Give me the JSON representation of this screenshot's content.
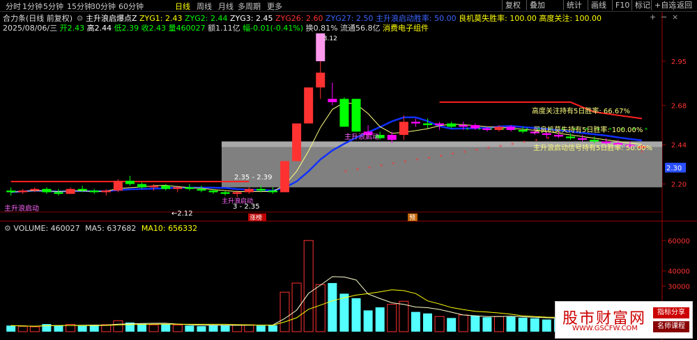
{
  "toolbar": {
    "periods": [
      "分时",
      "1分钟",
      "5分钟",
      "15分钟",
      "30分钟",
      "60分钟",
      "日线",
      "周线",
      "月线",
      "多周期",
      "更多"
    ],
    "active_period": "日线",
    "right_buttons": [
      "复权",
      "叠加",
      "统计",
      "画线",
      "F10",
      "标记",
      "+自选",
      "返回"
    ]
  },
  "info": {
    "line1_prefix": "合力条(日线 前复权)",
    "indicator_name": "主升浪启爆点Z",
    "zyg1": "ZYG1: 2.43",
    "zyg2": "ZYG2: 2.44",
    "zyg3": "ZYG3: 2.45",
    "zyg26": "ZYG26: 2.60",
    "zyg27": "ZYG27: 2.50",
    "rate_main": "主升浪启动胜率: 50.00",
    "rate_good": "良机莫失胜率: 100.00",
    "rate_focus": "高度关注: 100.00",
    "date": "2025/08/06/三",
    "open": "开2.43",
    "high": "高2.44",
    "low": "低2.39",
    "close": "收2.43",
    "volume": "量460027",
    "amount": "额1.11亿",
    "change": "幅-0.01(-0.41%)",
    "turnover": "换0.81%",
    "float": "流通56.8亿",
    "sector": "消费电子组件",
    "close_icon": "close-icon",
    "settings_icon": "gear-icon",
    "zoom_in_icon": "zoom-in-icon",
    "zoom_out_icon": "zoom-out-icon"
  },
  "annotations": {
    "peak": "3.12",
    "focus_rate": "高度关注持有5日胜率:  66.67%",
    "good_rate": "买良机莫失持有5日胜率:  100.00%",
    "main_rate": "主升浪启动信号持有5日胜率:  50.00%",
    "band_top": "2.35 - 2.39",
    "band_bottom": "3 - 2.35",
    "low_mark": "←2.12",
    "start_left": "主升浪启动",
    "start_mid": "主升浪启动",
    "start_right": "主升浪启动",
    "limit_tag": "涨榜",
    "pre_tag": "预",
    "current_price": "2.30"
  },
  "price_axis": [
    "2.95",
    "2.68",
    "2.44",
    "2.20"
  ],
  "volume_info": {
    "label": "VOLUME: 460027",
    "ma5": "MA5: 637682",
    "ma10": "MA10: 656332"
  },
  "volume_axis": [
    "60000",
    "40000",
    "30000"
  ],
  "watermark": {
    "title": "股市财富网",
    "url": "WWW.GSCFW.COM",
    "tag1": "指标分享",
    "tag2": "名师课程"
  },
  "colors": {
    "up": "#ff3232",
    "down": "#00ff00",
    "pink": "#ff00ff",
    "volume": "#54ffff",
    "ma": "#0000ff",
    "band": "#808080"
  },
  "chart_data": {
    "type": "candlestick",
    "price_range": [
      2.05,
      3.12
    ],
    "candles": [
      [
        2.16,
        2.18,
        2.13,
        2.15
      ],
      [
        2.15,
        2.17,
        2.14,
        2.16
      ],
      [
        2.16,
        2.18,
        2.15,
        2.17
      ],
      [
        2.17,
        2.18,
        2.14,
        2.15
      ],
      [
        2.15,
        2.17,
        2.13,
        2.14
      ],
      [
        2.14,
        2.18,
        2.14,
        2.17
      ],
      [
        2.17,
        2.19,
        2.15,
        2.16
      ],
      [
        2.16,
        2.17,
        2.14,
        2.15
      ],
      [
        2.15,
        2.17,
        2.13,
        2.16
      ],
      [
        2.16,
        2.23,
        2.15,
        2.22
      ],
      [
        2.22,
        2.25,
        2.19,
        2.2
      ],
      [
        2.2,
        2.21,
        2.17,
        2.18
      ],
      [
        2.18,
        2.2,
        2.16,
        2.19
      ],
      [
        2.19,
        2.2,
        2.16,
        2.17
      ],
      [
        2.17,
        2.19,
        2.15,
        2.18
      ],
      [
        2.18,
        2.2,
        2.16,
        2.17
      ],
      [
        2.17,
        2.19,
        2.15,
        2.16
      ],
      [
        2.16,
        2.17,
        2.14,
        2.15
      ],
      [
        2.15,
        2.16,
        2.13,
        2.14
      ],
      [
        2.14,
        2.16,
        2.12,
        2.15
      ],
      [
        2.15,
        2.18,
        2.14,
        2.17
      ],
      [
        2.17,
        2.19,
        2.15,
        2.16
      ],
      [
        2.16,
        2.18,
        2.14,
        2.15
      ],
      [
        2.15,
        2.34,
        2.15,
        2.34
      ],
      [
        2.34,
        2.57,
        2.34,
        2.57
      ],
      [
        2.57,
        2.79,
        2.57,
        2.79
      ],
      [
        2.79,
        2.95,
        2.72,
        2.88
      ],
      [
        2.72,
        2.82,
        2.68,
        2.7
      ],
      [
        2.72,
        2.73,
        2.55,
        2.55
      ],
      [
        2.72,
        2.72,
        2.52,
        2.52
      ],
      [
        2.52,
        2.56,
        2.48,
        2.5
      ],
      [
        2.5,
        2.52,
        2.47,
        2.48
      ],
      [
        2.47,
        2.52,
        2.45,
        2.5
      ],
      [
        2.5,
        2.62,
        2.47,
        2.58
      ],
      [
        2.58,
        2.6,
        2.55,
        2.57
      ],
      [
        2.57,
        2.6,
        2.54,
        2.56
      ],
      [
        2.56,
        2.58,
        2.53,
        2.57
      ],
      [
        2.57,
        2.58,
        2.54,
        2.55
      ],
      [
        2.55,
        2.58,
        2.53,
        2.56
      ],
      [
        2.56,
        2.57,
        2.53,
        2.54
      ],
      [
        2.54,
        2.55,
        2.52,
        2.53
      ],
      [
        2.53,
        2.56,
        2.52,
        2.55
      ],
      [
        2.55,
        2.56,
        2.52,
        2.53
      ],
      [
        2.53,
        2.55,
        2.51,
        2.52
      ],
      [
        2.52,
        2.54,
        2.5,
        2.51
      ],
      [
        2.51,
        2.52,
        2.48,
        2.5
      ],
      [
        2.5,
        2.52,
        2.48,
        2.49
      ],
      [
        2.49,
        2.51,
        2.47,
        2.48
      ],
      [
        2.48,
        2.5,
        2.46,
        2.47
      ],
      [
        2.47,
        2.49,
        2.45,
        2.46
      ],
      [
        2.46,
        2.48,
        2.44,
        2.45
      ],
      [
        2.45,
        2.47,
        2.43,
        2.44
      ],
      [
        2.44,
        2.46,
        2.42,
        2.43
      ],
      [
        2.43,
        2.44,
        2.39,
        2.43
      ]
    ],
    "volumes": [
      4000,
      3500,
      3200,
      5000,
      4200,
      4800,
      3800,
      4000,
      4600,
      7200,
      6000,
      5200,
      4500,
      4800,
      4400,
      4000,
      3600,
      4200,
      4400,
      4600,
      4500,
      4000,
      4200,
      26000,
      32000,
      60000,
      31000,
      32000,
      25000,
      22000,
      14000,
      16000,
      18000,
      20000,
      13000,
      12000,
      10000,
      9000,
      11000,
      10500,
      9500,
      10000,
      9800,
      9200,
      8800,
      8000,
      8500,
      8200,
      7800,
      7500,
      7200,
      7000,
      6800,
      6500
    ]
  }
}
